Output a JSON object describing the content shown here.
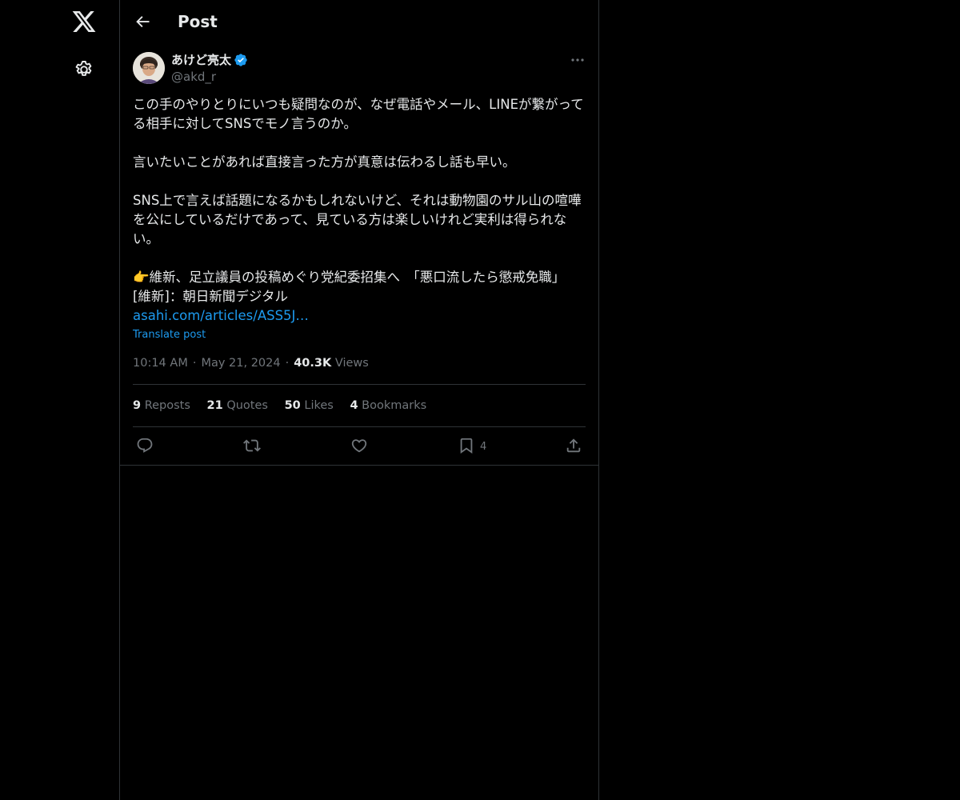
{
  "header": {
    "title": "Post"
  },
  "post": {
    "author_name": "あけど亮太",
    "author_handle": "@akd_r",
    "paragraphs": [
      "この手のやりとりにいつも疑問なのが、なぜ電話やメール、LINEが繋がってる相手に対してSNSでモノ言うのか。",
      "言いたいことがあれば直接言った方が真意は伝わるし話も早い。",
      "SNS上で言えば話題になるかもしれないけど、それは動物園のサル山の喧嘩を公にしているだけであって、見ている方は楽しいけれど実利は得られない。"
    ],
    "quoted_text": "👉維新、足立議員の投稿めぐり党紀委招集へ　「悪口流したら懲戒免職」 [維新]：朝日新聞デジタル",
    "link_text": "asahi.com/articles/ASS5J…",
    "translate_label": "Translate post",
    "time": "10:14 AM",
    "date": "May 21, 2024",
    "views_count": "40.3K",
    "views_label": "Views"
  },
  "stats": [
    {
      "count": "9",
      "label": "Reposts"
    },
    {
      "count": "21",
      "label": "Quotes"
    },
    {
      "count": "50",
      "label": "Likes"
    },
    {
      "count": "4",
      "label": "Bookmarks"
    }
  ],
  "actions": {
    "bookmark_count": "4"
  },
  "colors": {
    "background": "#000000",
    "text": "#e7e9ea",
    "muted": "#71767b",
    "accent": "#1d9bf0",
    "border": "#2f3336"
  },
  "icons": {
    "logo": "x-logo-icon",
    "settings": "gear-icon",
    "back": "arrow-left-icon",
    "verified": "verified-badge-icon",
    "more": "more-horizontal-icon",
    "reply": "reply-icon",
    "repost": "repost-icon",
    "like": "heart-icon",
    "bookmark": "bookmark-icon",
    "share": "share-icon"
  }
}
